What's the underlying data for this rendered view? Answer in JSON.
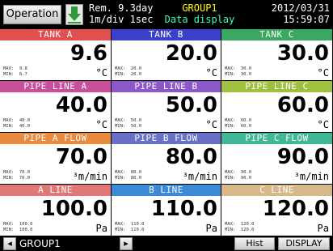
{
  "header": {
    "operation_label": "Operation",
    "rem_line": "Rem. 9.3day",
    "rate_line": "1m/div 1sec",
    "group_name": "GROUP1",
    "screen_name": "Data display",
    "date": "2012/03/31",
    "time": "15:59:07"
  },
  "channels": [
    {
      "title": "TANK A",
      "color": "#e05050",
      "value": "9.6",
      "unit": "°C",
      "max_label": "MAX:",
      "max": "9.8",
      "min_label": "MIN:",
      "min": "8.7"
    },
    {
      "title": "TANK B",
      "color": "#3a40c8",
      "value": "20.0",
      "unit": "°C",
      "max_label": "MAX:",
      "max": "20.0",
      "min_label": "MIN:",
      "min": "20.0"
    },
    {
      "title": "TANK C",
      "color": "#3aa860",
      "value": "30.0",
      "unit": "°C",
      "max_label": "MAX:",
      "max": "30.0",
      "min_label": "MIN:",
      "min": "30.0"
    },
    {
      "title": "PIPE LINE A",
      "color": "#c8509a",
      "value": "40.0",
      "unit": "°C",
      "max_label": "MAX:",
      "max": "40.0",
      "min_label": "MIN:",
      "min": "40.0"
    },
    {
      "title": "PIPE LINE B",
      "color": "#8a58c8",
      "value": "50.0",
      "unit": "°C",
      "max_label": "MAX:",
      "max": "50.0",
      "min_label": "MIN:",
      "min": "50.0"
    },
    {
      "title": "PIPE LINE C",
      "color": "#a0c040",
      "value": "60.0",
      "unit": "°C",
      "max_label": "MAX:",
      "max": "60.0",
      "min_label": "MIN:",
      "min": "60.0"
    },
    {
      "title": "PIPE A FLOW",
      "color": "#e88a40",
      "value": "70.0",
      "unit": "³m/min",
      "max_label": "MAX:",
      "max": "70.0",
      "min_label": "MIN:",
      "min": "70.0"
    },
    {
      "title": "PIPE B FLOW",
      "color": "#6870c8",
      "value": "80.0",
      "unit": "³m/min",
      "max_label": "MAX:",
      "max": "80.0",
      "min_label": "MIN:",
      "min": "80.0"
    },
    {
      "title": "PIPE C FLOW",
      "color": "#40b898",
      "value": "90.0",
      "unit": "³m/min",
      "max_label": "MAX:",
      "max": "90.0",
      "min_label": "MIN:",
      "min": "90.0"
    },
    {
      "title": "A LINE",
      "color": "#e07878",
      "value": "100.0",
      "unit": "Pa",
      "max_label": "MAX:",
      "max": "100.0",
      "min_label": "MIN:",
      "min": "100.0"
    },
    {
      "title": "B LINE",
      "color": "#3a8ad8",
      "value": "110.0",
      "unit": "Pa",
      "max_label": "MAX:",
      "max": "110.0",
      "min_label": "MIN:",
      "min": "110.0"
    },
    {
      "title": "C LINE",
      "color": "#d8b888",
      "value": "120.0",
      "unit": "Pa",
      "max_label": "MAX:",
      "max": "120.0",
      "min_label": "MIN:",
      "min": "120.0"
    }
  ],
  "footer": {
    "prev_icon": "◂",
    "group_label": "GROUP1",
    "next_icon": "▸",
    "hist_label": "Hist",
    "display_label": "DISPLAY"
  }
}
